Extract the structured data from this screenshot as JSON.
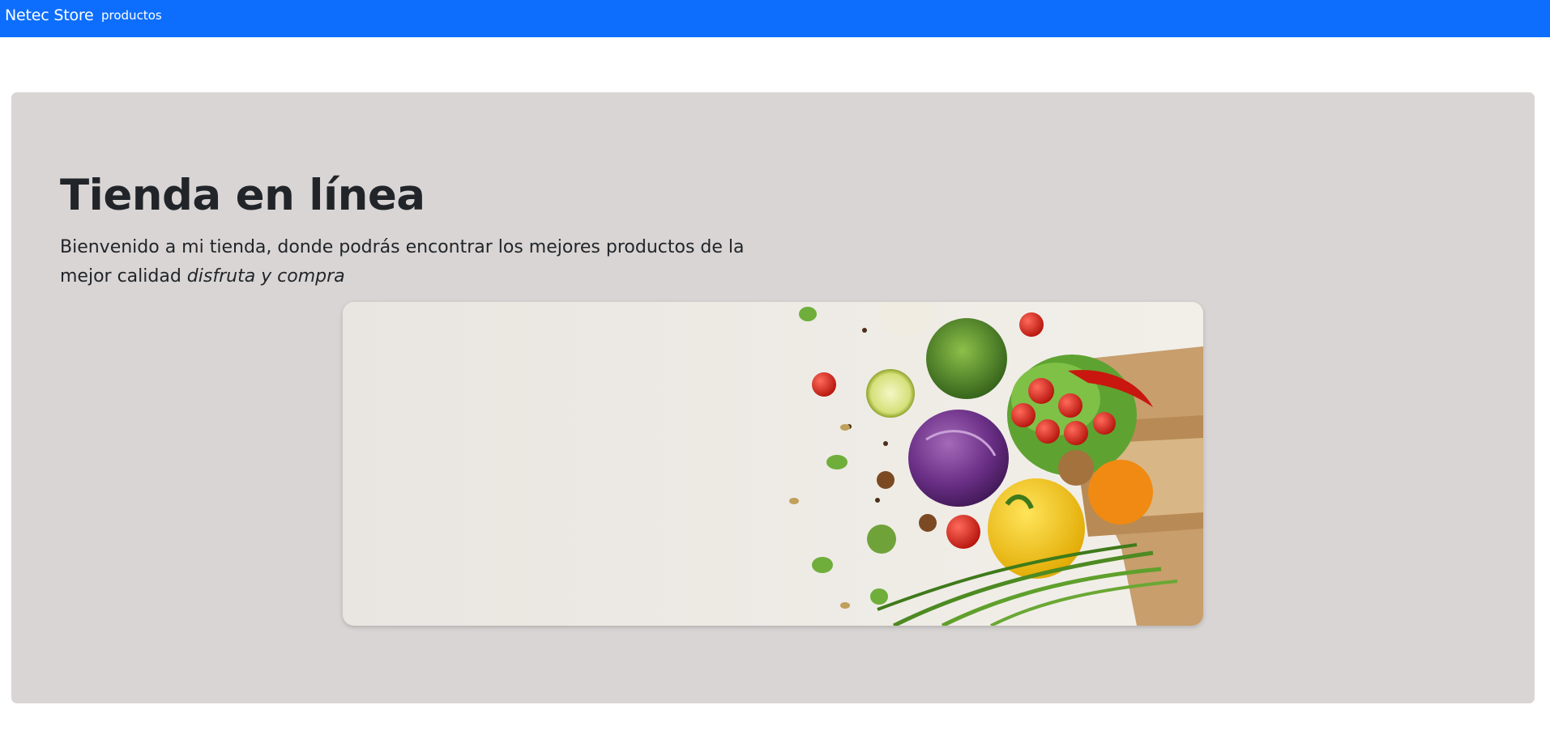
{
  "navbar": {
    "brand": "Netec Store",
    "links": [
      {
        "label": "productos"
      }
    ],
    "color": "#0d6efd"
  },
  "hero": {
    "title": "Tienda en línea",
    "lead_text": "Bienvenido a mi tienda, donde podrás encontrar los mejores productos de la mejor calidad",
    "lead_emphasis": "disfruta y compra",
    "background": "#d9d5d5"
  },
  "banner": {
    "icon": "vegetables-grocery-bag-image"
  }
}
